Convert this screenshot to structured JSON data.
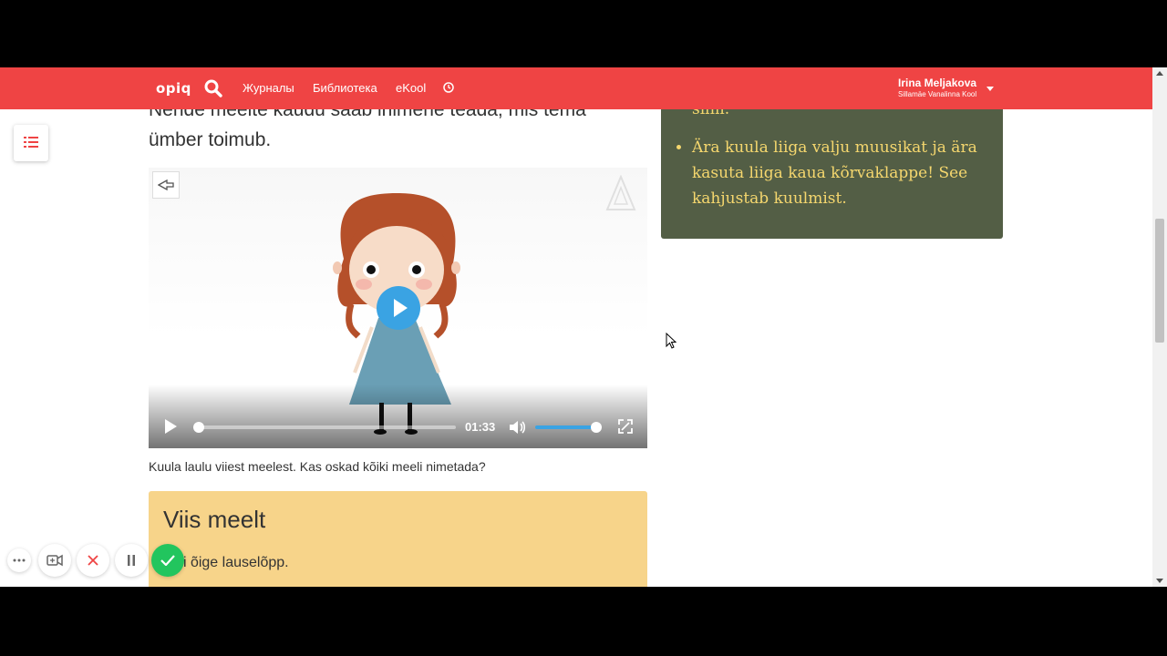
{
  "navbar": {
    "logo": "opiq",
    "links": [
      {
        "label": "Журналы"
      },
      {
        "label": "Библиотека"
      },
      {
        "label": "eKool"
      }
    ],
    "user_name": "Irina Meljakova",
    "user_school": "Sillamäe Vanalinna Kool"
  },
  "content": {
    "lead_text_cut": "Nende meelte kaudu saab inimene teada, mis tema",
    "lead_text": "ümber toimub.",
    "video": {
      "time": "01:33",
      "progress": 0.0,
      "volume": 0.9
    },
    "caption": "Kuula laulu viiest meelest. Kas oskad kõiki meeli nimetada?",
    "task": {
      "title": "Viis meelt",
      "description": "Vali õige lauselõpp."
    }
  },
  "sidebar_info": {
    "prev_fragment": "silm.",
    "items": [
      "Ära kuula liiga valju muusikat ja ära kasuta liiga kaua kõrvaklappe! See kahjustab kuulmist."
    ]
  },
  "colors": {
    "navbar": "#ef4444",
    "info_box": "#535e45",
    "info_text": "#f5d76e",
    "task_box": "#f7d48a",
    "video_accent": "#3aa3e3",
    "record_confirm": "#22c55e"
  }
}
